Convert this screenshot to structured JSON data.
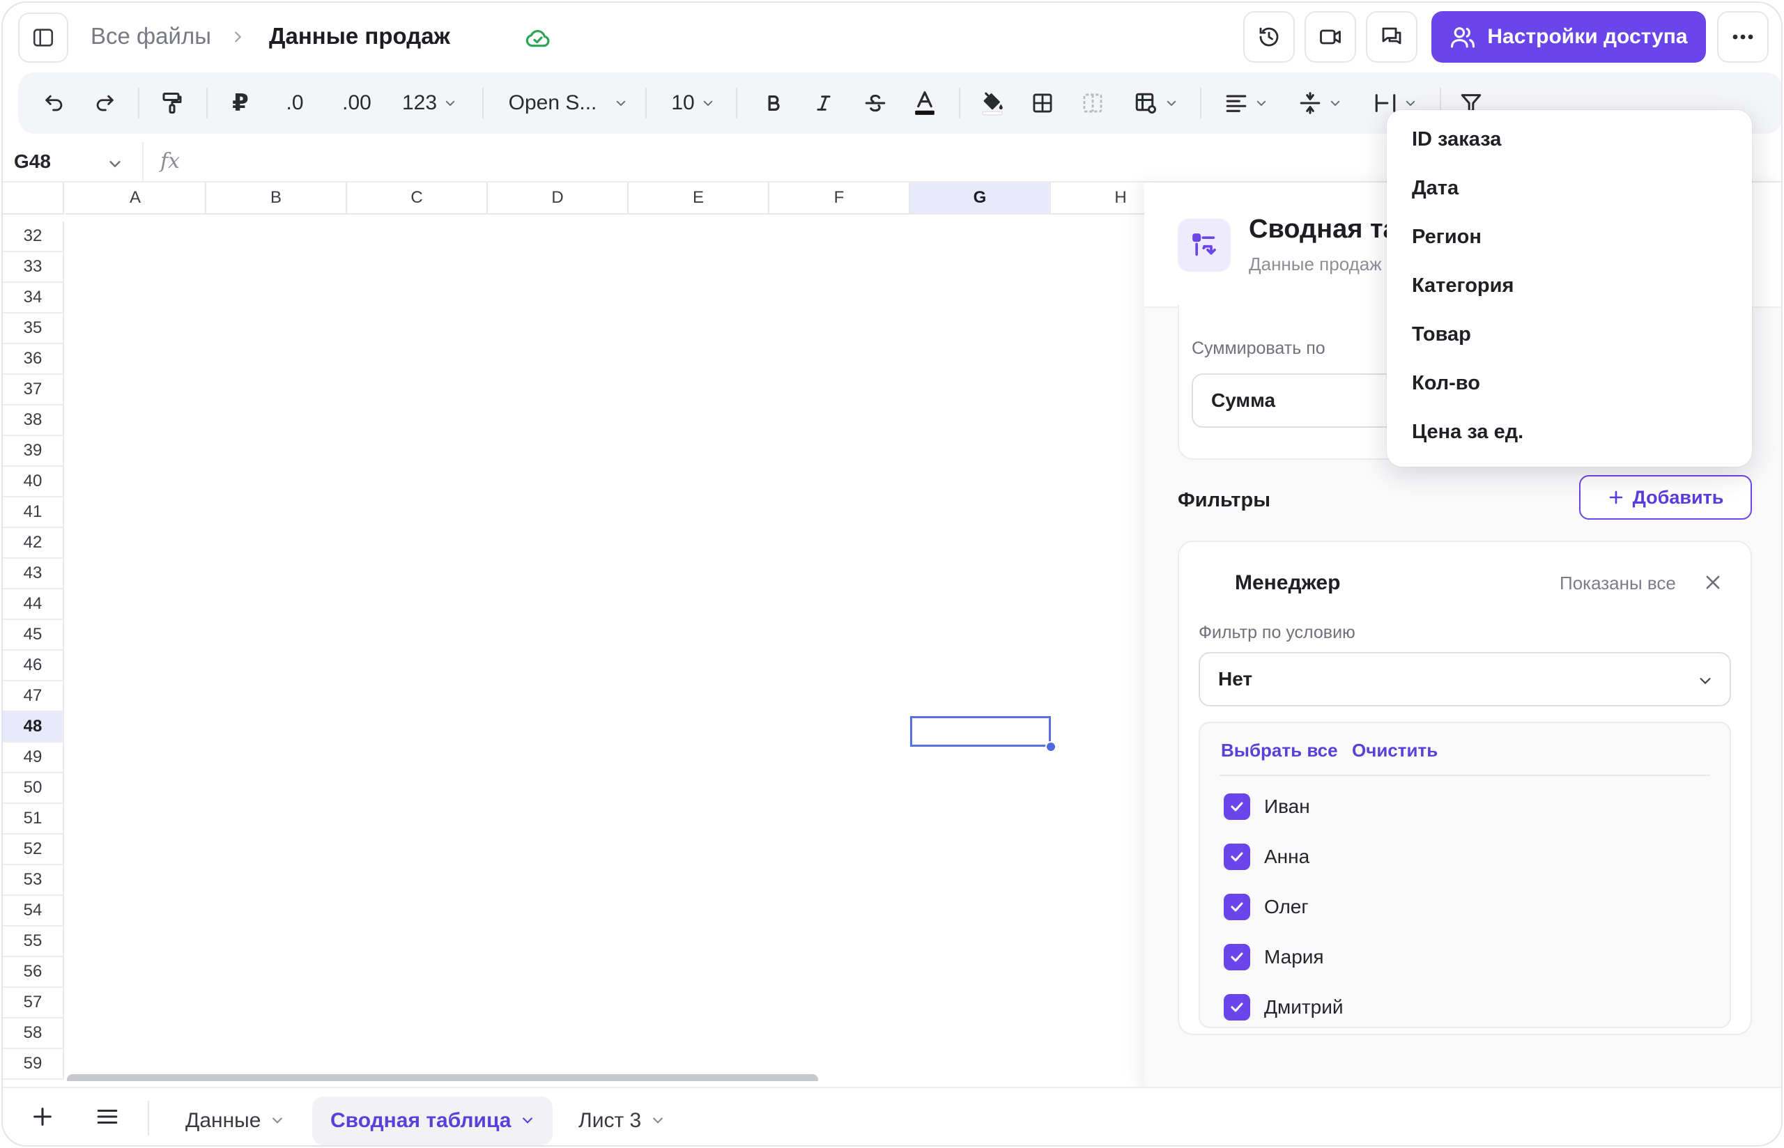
{
  "header": {
    "breadcrumb_root": "Все файлы",
    "file_name": "Данные продаж",
    "share_label": "Настройки доступа"
  },
  "toolbar": {
    "currency": "₽",
    "decrease_decimal": ".0",
    "increase_decimal": ".00",
    "number_format": "123",
    "font_name": "Open S...",
    "font_size": "10"
  },
  "formula_bar": {
    "cell_ref": "G48",
    "fx_label": "fx",
    "value": ""
  },
  "grid": {
    "columns": [
      "A",
      "B",
      "C",
      "D",
      "E",
      "F",
      "G",
      "H"
    ],
    "selected_column": "G",
    "rows": [
      "32",
      "33",
      "34",
      "35",
      "36",
      "37",
      "38",
      "39",
      "40",
      "41",
      "42",
      "43",
      "44",
      "45",
      "46",
      "47",
      "48",
      "49",
      "50",
      "51",
      "52",
      "53",
      "54",
      "55",
      "56",
      "57",
      "58",
      "59"
    ],
    "selected_row": "48"
  },
  "panel": {
    "title": "Сводная та",
    "subtitle": "Данные продаж",
    "summarize_label": "Суммировать по",
    "summarize_value": "Сумма",
    "filters_title": "Фильтры",
    "add_label": "Добавить",
    "filter": {
      "field": "Менеджер",
      "status": "Показаны все",
      "condition_label": "Фильтр по условию",
      "condition_value": "Нет",
      "select_all": "Выбрать все",
      "clear": "Очистить",
      "values": [
        "Иван",
        "Анна",
        "Олег",
        "Мария",
        "Дмитрий"
      ]
    }
  },
  "dropdown": {
    "items": [
      "ID заказа",
      "Дата",
      "Регион",
      "Категория",
      "Товар",
      "Кол-во",
      "Цена за ед."
    ]
  },
  "sheets": {
    "tabs": [
      "Данные",
      "Сводная таблица",
      "Лист 3"
    ],
    "active": "Сводная таблица"
  },
  "colors": {
    "accent": "#6a45ea",
    "selection": "#5a72e0",
    "saved": "#2fa35a"
  }
}
